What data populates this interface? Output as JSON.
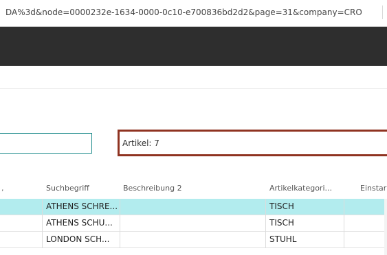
{
  "browser": {
    "url": "DA%3d&node=0000232e-1634-0000-0c10-e700836bd2d2&page=31&company=CRO"
  },
  "filters": {
    "right_label": "Artikel: 7"
  },
  "table": {
    "columns": [
      "Suchbegriff",
      "Beschreibung 2",
      "Artikelkategori...",
      "Einstar"
    ],
    "rows": [
      {
        "suchbegriff": "ATHENS SCHRE...",
        "beschreibung2": "",
        "artikelkategorie": "TISCH",
        "selected": true
      },
      {
        "suchbegriff": "ATHENS SCHU...",
        "beschreibung2": "",
        "artikelkategorie": "TISCH",
        "selected": false
      },
      {
        "suchbegriff": "LONDON SCH...",
        "beschreibung2": "",
        "artikelkategorie": "STUHL",
        "selected": false
      }
    ]
  },
  "colors": {
    "topbar": "#2e2e2e",
    "selected_row": "#b2ecee",
    "focus_border": "#8f3321",
    "field_border": "#1d8b8b"
  }
}
